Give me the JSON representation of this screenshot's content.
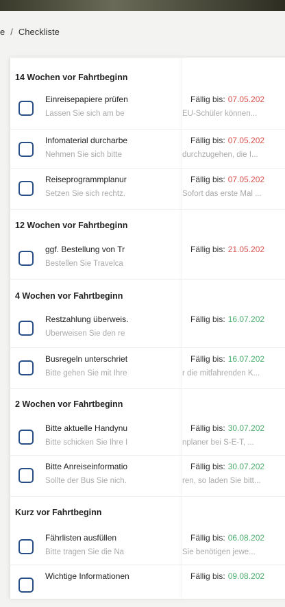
{
  "breadcrumb": {
    "first": "e",
    "separator": "/",
    "current": "Checkliste"
  },
  "label_due": "Fällig bis:",
  "colors": {
    "overdue": "#d9534f",
    "upcoming": "#4caf6f",
    "checkbox_border": "#274e86"
  },
  "sections": [
    {
      "title": "14 Wochen vor Fahrtbeginn"
    },
    {
      "title": "12 Wochen vor Fahrtbeginn"
    },
    {
      "title": "4 Wochen vor Fahrtbeginn"
    },
    {
      "title": "2 Wochen vor Fahrtbeginn"
    },
    {
      "title": "Kurz vor Fahrtbeginn"
    }
  ],
  "tasks": [
    {
      "title": "Einreisepapiere prüfen",
      "desc": "Lassen Sie sich am be",
      "due": "07.05.202",
      "due_desc": "EU-Schüler können...",
      "status": "overdue"
    },
    {
      "title": "Infomaterial durcharbe",
      "desc": "Nehmen Sie sich bitte",
      "due": "07.05.202",
      "due_desc": "durchzugehen, die I...",
      "status": "overdue"
    },
    {
      "title": "Reiseprogrammplanur",
      "desc": "Setzen Sie sich rechtz.",
      "due": "07.05.202",
      "due_desc": "Sofort das erste Mal ...",
      "status": "overdue"
    },
    {
      "title": "ggf. Bestellung von Tr",
      "desc": "Bestellen Sie Travelca",
      "due": "21.05.202",
      "due_desc": "",
      "status": "overdue"
    },
    {
      "title": "Restzahlung überweis.",
      "desc": "Überweisen Sie den re",
      "due": "16.07.202",
      "due_desc": "",
      "status": "upcoming"
    },
    {
      "title": "Busregeln unterschriet",
      "desc": "Bitte gehen Sie mit Ihre",
      "due": "16.07.202",
      "due_desc": "r die mitfahrenden K...",
      "status": "upcoming"
    },
    {
      "title": "Bitte aktuelle Handynu",
      "desc": "Bitte schicken Sie Ihre I",
      "due": "30.07.202",
      "due_desc": "nplaner bei S-E-T, ...",
      "status": "upcoming"
    },
    {
      "title": "Bitte Anreiseinformatio",
      "desc": "Sollte der Bus Sie nich.",
      "due": "30.07.202",
      "due_desc": "ren, so laden Sie bitt...",
      "status": "upcoming"
    },
    {
      "title": "Fährlisten ausfüllen",
      "desc": "Bitte tragen Sie die Na",
      "due": "06.08.202",
      "due_desc": "Sie benötigen jewe...",
      "status": "upcoming"
    },
    {
      "title": "Wichtige Informationen",
      "desc": "",
      "due": "09.08.202",
      "due_desc": "",
      "status": "upcoming"
    }
  ]
}
